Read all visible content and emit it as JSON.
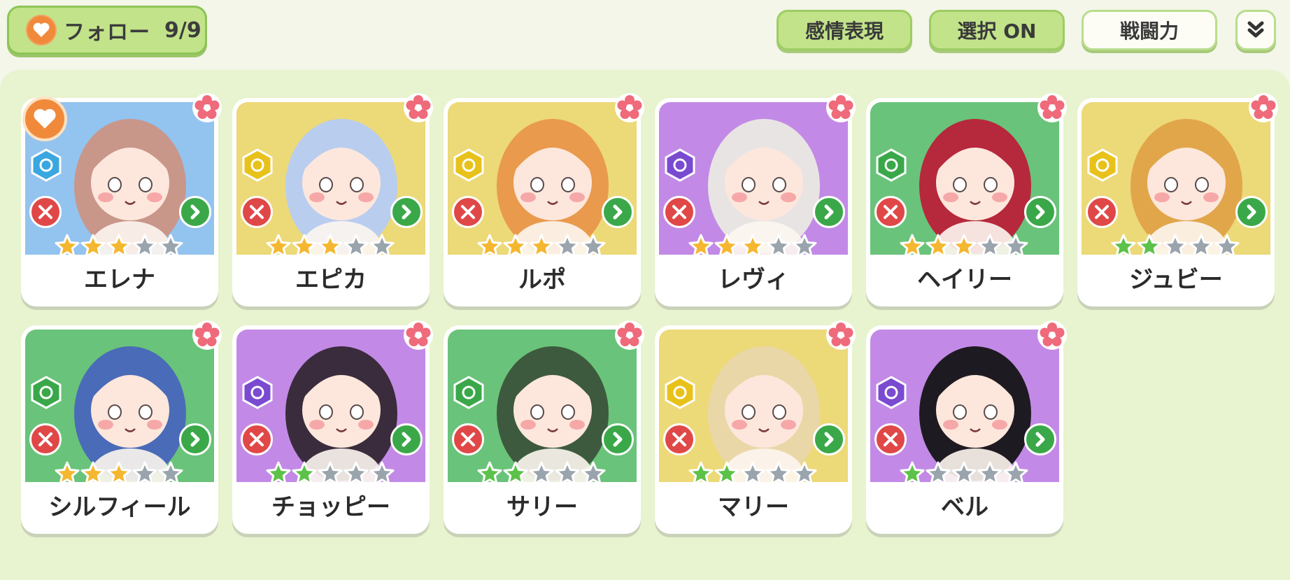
{
  "header": {
    "follow_label": "フォロー",
    "follow_count": "9/9",
    "buttons": [
      {
        "label": "感情表現",
        "style": "green"
      },
      {
        "label": "選択 ON",
        "style": "green"
      },
      {
        "label": "戦闘力",
        "style": "white"
      }
    ],
    "collapse_icon": "chevron-double-down-icon"
  },
  "colors": {
    "blue": "#93c3ef",
    "yellow": "#ecd978",
    "purple": "#c28ae6",
    "green": "#6ac37a",
    "star_gold": "#f5b730",
    "star_green": "#5cc24a",
    "star_empty": "#9aa4ad"
  },
  "characters": [
    {
      "name": "エレナ",
      "bg": "blue",
      "element": "ice",
      "stars": 3,
      "star_color": "gold",
      "favorite": true
    },
    {
      "name": "エピカ",
      "bg": "yellow",
      "element": "light",
      "stars": 3,
      "star_color": "gold",
      "favorite": false
    },
    {
      "name": "ルポ",
      "bg": "yellow",
      "element": "light",
      "stars": 3,
      "star_color": "gold",
      "favorite": false
    },
    {
      "name": "レヴィ",
      "bg": "purple",
      "element": "dark",
      "stars": 3,
      "star_color": "gold",
      "favorite": false
    },
    {
      "name": "ヘイリー",
      "bg": "green",
      "element": "nature",
      "stars": 3,
      "star_color": "gold",
      "favorite": false
    },
    {
      "name": "ジュビー",
      "bg": "yellow",
      "element": "light",
      "stars": 2,
      "star_color": "green",
      "favorite": false
    },
    {
      "name": "シルフィール",
      "bg": "green",
      "element": "nature",
      "stars": 3,
      "star_color": "gold",
      "favorite": false
    },
    {
      "name": "チョッピー",
      "bg": "purple",
      "element": "dark",
      "stars": 2,
      "star_color": "green",
      "favorite": false
    },
    {
      "name": "サリー",
      "bg": "green",
      "element": "nature",
      "stars": 2,
      "star_color": "green",
      "favorite": false
    },
    {
      "name": "マリー",
      "bg": "yellow",
      "element": "light",
      "stars": 2,
      "star_color": "green",
      "favorite": false
    },
    {
      "name": "ベル",
      "bg": "purple",
      "element": "dark",
      "stars": 1,
      "star_color": "green",
      "favorite": false
    }
  ]
}
